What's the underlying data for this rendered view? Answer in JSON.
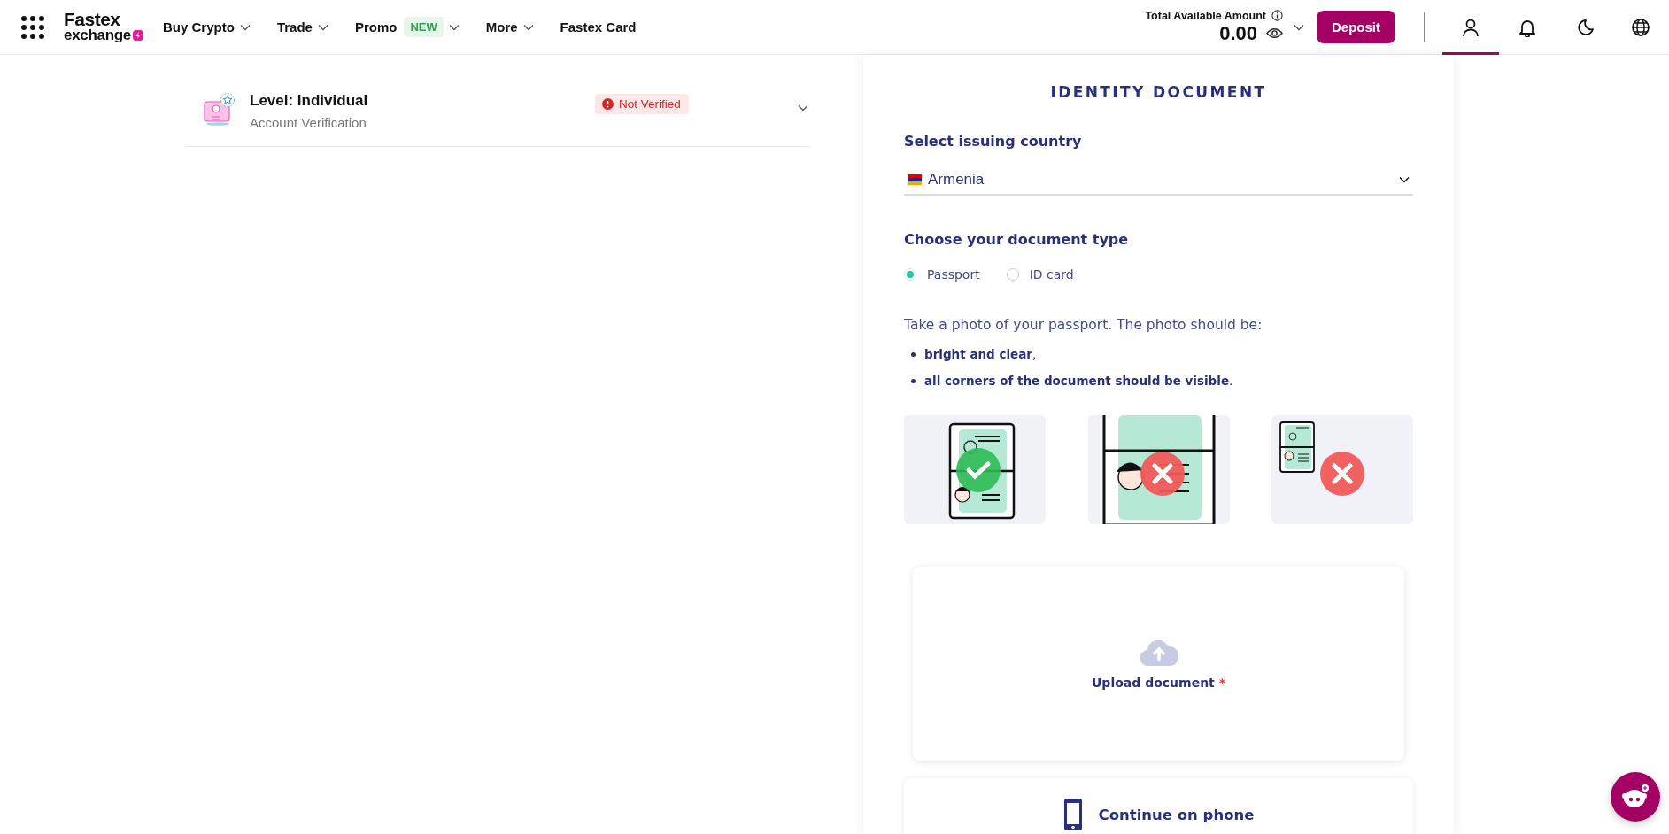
{
  "header": {
    "logo": {
      "line_1": "Fastex",
      "line_2": "exchange"
    },
    "nav": [
      {
        "label": "Buy Crypto",
        "dropdown": true
      },
      {
        "label": "Trade",
        "dropdown": true
      },
      {
        "label": "Promo",
        "badge": "NEW",
        "dropdown": true
      },
      {
        "label": "More",
        "dropdown": true
      },
      {
        "label": "Fastex Card",
        "dropdown": false
      }
    ],
    "balance": {
      "label": "Total Available Amount",
      "amount": "0.00"
    },
    "deposit_button": "Deposit",
    "icons": [
      {
        "kind": "user",
        "selected": true
      },
      {
        "kind": "bell",
        "selected": false
      },
      {
        "kind": "moon",
        "selected": false
      },
      {
        "kind": "globe",
        "selected": false
      }
    ]
  },
  "level_card": {
    "title": "Level: Individual",
    "subtitle": "Account Verification",
    "status": "Not Verified"
  },
  "identity": {
    "title": "IDENTITY DOCUMENT",
    "country_label": "Select issuing country",
    "country": "Armenia",
    "type_label": "Choose your document type",
    "types": [
      {
        "label": "Passport",
        "selected": true
      },
      {
        "label": "ID card",
        "selected": false
      }
    ],
    "instructions": "Take a photo of your passport. The photo should be:",
    "requirements": [
      "**bright and clear**,",
      "**all corners of the document should be visible**."
    ],
    "examples": [
      {
        "kind": "fit",
        "acceptable": true
      },
      {
        "kind": "close",
        "acceptable": false
      },
      {
        "kind": "far",
        "acceptable": false
      }
    ],
    "upload": {
      "label": "Upload document",
      "required_mark": "*"
    },
    "phone_button": "Continue on phone"
  }
}
